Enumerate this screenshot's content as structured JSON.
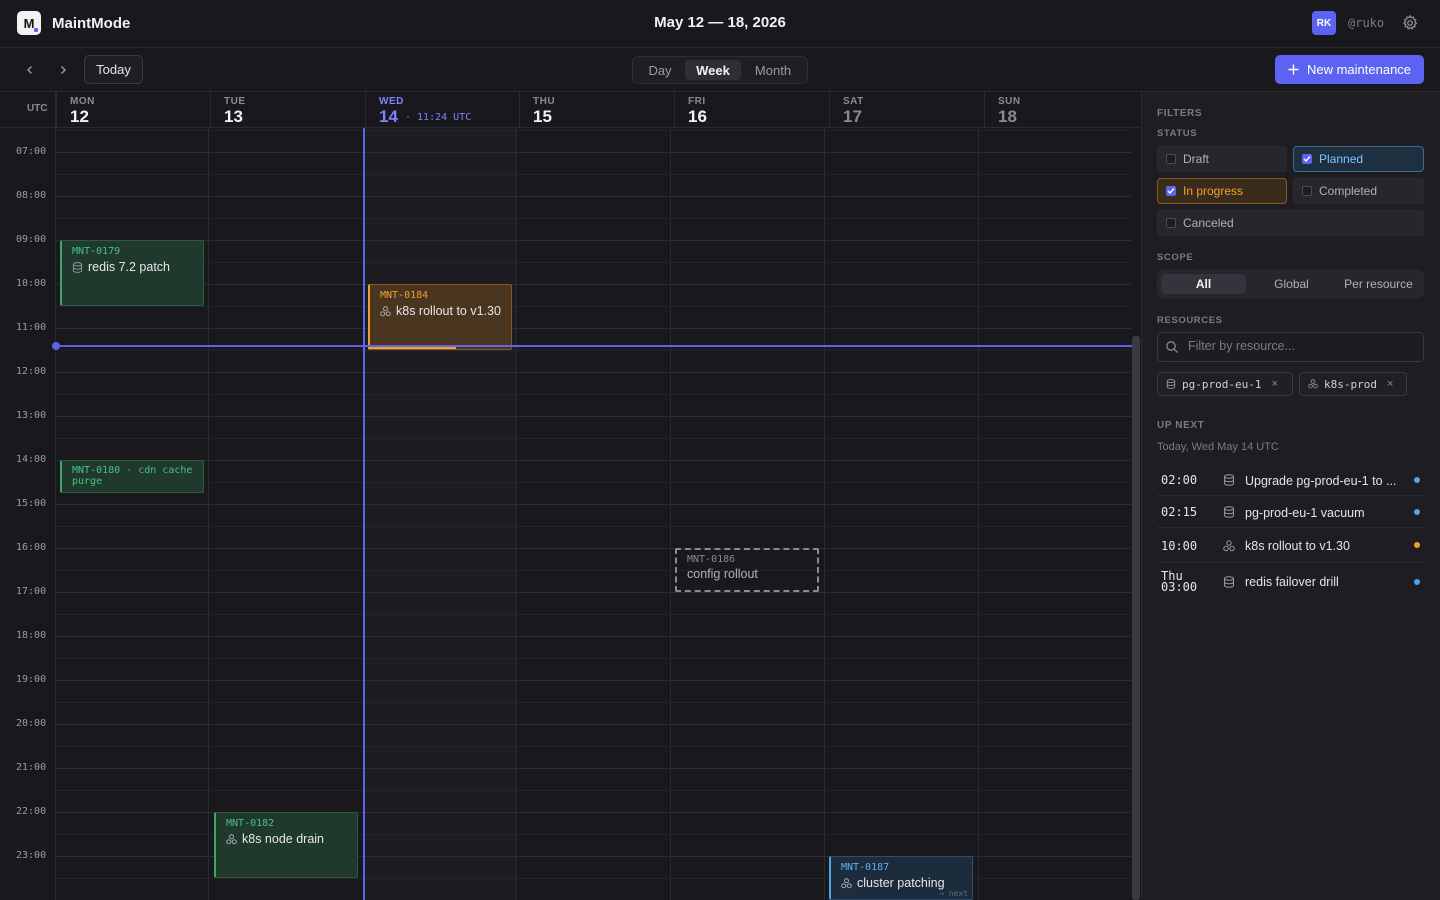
{
  "app": {
    "name": "MaintMode",
    "logo_letter": "M",
    "date_range": "May 12 — 18, 2026"
  },
  "user": {
    "initials": "RK",
    "handle": "@ruko"
  },
  "toolbar": {
    "today_label": "Today",
    "views": [
      "Day",
      "Week",
      "Month"
    ],
    "active_view": "Week",
    "new_label": "New maintenance"
  },
  "calendar": {
    "tz_label": "UTC",
    "now_label": "· 11:24 UTC",
    "days": [
      {
        "dow": "MON",
        "num": "12"
      },
      {
        "dow": "TUE",
        "num": "13"
      },
      {
        "dow": "WED",
        "num": "14"
      },
      {
        "dow": "THU",
        "num": "15"
      },
      {
        "dow": "FRI",
        "num": "16"
      },
      {
        "dow": "SAT",
        "num": "17"
      },
      {
        "dow": "SUN",
        "num": "18"
      }
    ],
    "hours": [
      "07:00",
      "08:00",
      "09:00",
      "10:00",
      "11:00",
      "12:00",
      "13:00",
      "14:00",
      "15:00",
      "16:00",
      "17:00",
      "18:00",
      "19:00",
      "20:00",
      "21:00",
      "22:00",
      "23:00"
    ],
    "events": {
      "e179": {
        "id": "MNT-0179",
        "title": "redis 7.2 patch",
        "icon": "database-icon",
        "status": "completed"
      },
      "e184": {
        "id": "MNT-0184",
        "title": "k8s rollout to v1.30",
        "icon": "cluster-icon",
        "status": "in-progress"
      },
      "e180": {
        "id": "MNT-0180 · cdn cache",
        "title": "purge",
        "status": "completed"
      },
      "e186": {
        "id": "MNT-0186",
        "title": "config rollout",
        "status": "draft"
      },
      "e182": {
        "id": "MNT-0182",
        "title": "k8s node drain",
        "icon": "cluster-icon",
        "status": "completed"
      },
      "e187": {
        "id": "MNT-0187",
        "title": "cluster patching",
        "icon": "cluster-icon",
        "status": "planned",
        "note": "→ next"
      }
    }
  },
  "filters": {
    "title": "FILTERS",
    "status_label": "STATUS",
    "statuses": {
      "draft": "Draft",
      "planned": "Planned",
      "in_progress": "In progress",
      "completed": "Completed",
      "canceled": "Canceled"
    },
    "scope_label": "SCOPE",
    "scopes": [
      "All",
      "Global",
      "Per resource"
    ],
    "active_scope": "All",
    "resources_label": "RESOURCES",
    "resource_placeholder": "Filter by resource...",
    "chips": [
      "pg-prod-eu-1",
      "k8s-prod"
    ]
  },
  "up_next": {
    "title": "UP NEXT",
    "subtitle": "Today, Wed May 14 UTC",
    "items": [
      {
        "time": "02:00",
        "title": "Upgrade pg-prod-eu-1 to ...",
        "icon": "database-icon",
        "dot": "#4aa5e8"
      },
      {
        "time": "02:15",
        "title": "pg-prod-eu-1 vacuum",
        "icon": "database-icon",
        "dot": "#4aa5e8"
      },
      {
        "time": "10:00",
        "title": "k8s rollout to v1.30",
        "icon": "cluster-icon",
        "dot": "#f0a030"
      },
      {
        "time_day": "Thu",
        "time": "03:00",
        "title": "redis failover drill",
        "icon": "database-icon",
        "dot": "#4aa5e8"
      }
    ]
  },
  "colors": {
    "accent": "#5b63f0",
    "in_progress": "#f0a030",
    "completed": "#3ba56a",
    "planned": "#4aa5e8"
  }
}
